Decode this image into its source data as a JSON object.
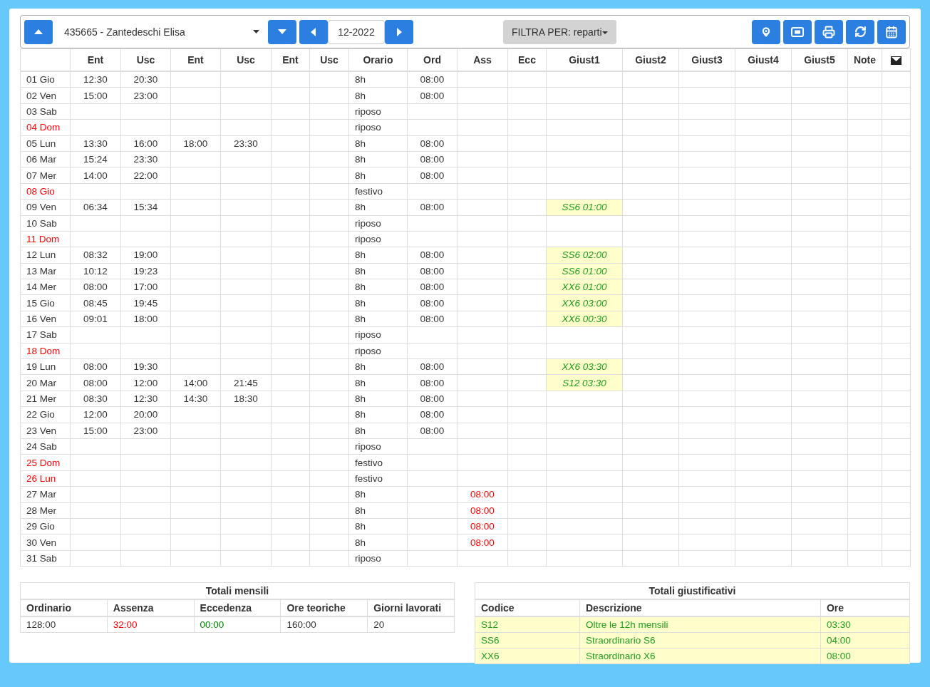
{
  "toolbar": {
    "employee": "435665 - Zantedeschi Elisa",
    "month": "12-2022",
    "filter": "FILTRA PER: reparti"
  },
  "columns": [
    {
      "kind": "text",
      "label": "Ent"
    },
    {
      "kind": "text",
      "label": "Usc"
    },
    {
      "kind": "text",
      "label": "Ent"
    },
    {
      "kind": "text",
      "label": "Usc"
    },
    {
      "kind": "text",
      "label": "Ent"
    },
    {
      "kind": "text",
      "label": "Usc"
    },
    {
      "kind": "text",
      "label": "Orario"
    },
    {
      "kind": "text",
      "label": "Ord"
    },
    {
      "kind": "text",
      "label": "Ass"
    },
    {
      "kind": "text",
      "label": "Ecc"
    },
    {
      "kind": "text",
      "label": "Giust1"
    },
    {
      "kind": "text",
      "label": "Giust2"
    },
    {
      "kind": "text",
      "label": "Giust3"
    },
    {
      "kind": "text",
      "label": "Giust4"
    },
    {
      "kind": "text",
      "label": "Giust5"
    },
    {
      "kind": "text",
      "label": "Note"
    },
    {
      "kind": "mail"
    }
  ],
  "rows": [
    {
      "day": "01 Gio",
      "holiday": false,
      "times": [
        "12:30",
        "20:30"
      ],
      "orario": "8h",
      "ord": "08:00"
    },
    {
      "day": "02 Ven",
      "holiday": false,
      "times": [
        "15:00",
        "23:00"
      ],
      "orario": "8h",
      "ord": "08:00"
    },
    {
      "day": "03 Sab",
      "holiday": false,
      "times": [],
      "orario": "riposo"
    },
    {
      "day": "04 Dom",
      "holiday": true,
      "times": [],
      "orario": "riposo"
    },
    {
      "day": "05 Lun",
      "holiday": false,
      "times": [
        "13:30",
        "16:00",
        "18:00",
        "23:30"
      ],
      "orario": "8h",
      "ord": "08:00"
    },
    {
      "day": "06 Mar",
      "holiday": false,
      "times": [
        "15:24",
        "23:30"
      ],
      "orario": "8h",
      "ord": "08:00"
    },
    {
      "day": "07 Mer",
      "holiday": false,
      "times": [
        "14:00",
        "22:00"
      ],
      "orario": "8h",
      "ord": "08:00"
    },
    {
      "day": "08 Gio",
      "holiday": true,
      "times": [],
      "orario": "festivo"
    },
    {
      "day": "09 Ven",
      "holiday": false,
      "times": [
        "06:34",
        "15:34"
      ],
      "orario": "8h",
      "ord": "08:00",
      "giust": "SS6 01:00"
    },
    {
      "day": "10 Sab",
      "holiday": false,
      "times": [],
      "orario": "riposo"
    },
    {
      "day": "11 Dom",
      "holiday": true,
      "times": [],
      "orario": "riposo"
    },
    {
      "day": "12 Lun",
      "holiday": false,
      "times": [
        "08:32",
        "19:00"
      ],
      "orario": "8h",
      "ord": "08:00",
      "giust": "SS6 02:00"
    },
    {
      "day": "13 Mar",
      "holiday": false,
      "times": [
        "10:12",
        "19:23"
      ],
      "orario": "8h",
      "ord": "08:00",
      "giust": "SS6 01:00"
    },
    {
      "day": "14 Mer",
      "holiday": false,
      "times": [
        "08:00",
        "17:00"
      ],
      "orario": "8h",
      "ord": "08:00",
      "giust": "XX6 01:00"
    },
    {
      "day": "15 Gio",
      "holiday": false,
      "times": [
        "08:45",
        "19:45"
      ],
      "orario": "8h",
      "ord": "08:00",
      "giust": "XX6 03:00"
    },
    {
      "day": "16 Ven",
      "holiday": false,
      "times": [
        "09:01",
        "18:00"
      ],
      "orario": "8h",
      "ord": "08:00",
      "giust": "XX6 00:30"
    },
    {
      "day": "17 Sab",
      "holiday": false,
      "times": [],
      "orario": "riposo"
    },
    {
      "day": "18 Dom",
      "holiday": true,
      "times": [],
      "orario": "riposo"
    },
    {
      "day": "19 Lun",
      "holiday": false,
      "times": [
        "08:00",
        "19:30"
      ],
      "orario": "8h",
      "ord": "08:00",
      "giust": "XX6 03:30"
    },
    {
      "day": "20 Mar",
      "holiday": false,
      "times": [
        "08:00",
        "12:00",
        "14:00",
        "21:45"
      ],
      "orario": "8h",
      "ord": "08:00",
      "giust": "S12 03:30"
    },
    {
      "day": "21 Mer",
      "holiday": false,
      "times": [
        "08:30",
        "12:30",
        "14:30",
        "18:30"
      ],
      "orario": "8h",
      "ord": "08:00"
    },
    {
      "day": "22 Gio",
      "holiday": false,
      "times": [
        "12:00",
        "20:00"
      ],
      "orario": "8h",
      "ord": "08:00"
    },
    {
      "day": "23 Ven",
      "holiday": false,
      "times": [
        "15:00",
        "23:00"
      ],
      "orario": "8h",
      "ord": "08:00"
    },
    {
      "day": "24 Sab",
      "holiday": false,
      "times": [],
      "orario": "riposo"
    },
    {
      "day": "25 Dom",
      "holiday": true,
      "times": [],
      "orario": "festivo"
    },
    {
      "day": "26 Lun",
      "holiday": true,
      "times": [],
      "orario": "festivo"
    },
    {
      "day": "27 Mar",
      "holiday": false,
      "times": [],
      "orario": "8h",
      "ass": "08:00"
    },
    {
      "day": "28 Mer",
      "holiday": false,
      "times": [],
      "orario": "8h",
      "ass": "08:00"
    },
    {
      "day": "29 Gio",
      "holiday": false,
      "times": [],
      "orario": "8h",
      "ass": "08:00"
    },
    {
      "day": "30 Ven",
      "holiday": false,
      "times": [],
      "orario": "8h",
      "ass": "08:00"
    },
    {
      "day": "31 Sab",
      "holiday": false,
      "times": [],
      "orario": "riposo"
    }
  ],
  "monthly_totals": {
    "title": "Totali mensili",
    "items": [
      {
        "label": "Ordinario",
        "value": "128:00",
        "color": "#333333"
      },
      {
        "label": "Assenza",
        "value": "32:00",
        "color": "#ff0000"
      },
      {
        "label": "Eccedenza",
        "value": "00:00",
        "color": "#008000"
      },
      {
        "label": "Ore teoriche",
        "value": "160:00",
        "color": "#333333"
      },
      {
        "label": "Giorni lavorati",
        "value": "20",
        "color": "#333333"
      }
    ]
  },
  "justification_totals": {
    "title": "Totali giustificativi",
    "columns": [
      "Codice",
      "Descrizione",
      "Ore"
    ],
    "rows": [
      [
        "S12",
        "Oltre le 12h mensili",
        "03:30"
      ],
      [
        "SS6",
        "Straordinario S6",
        "04:00"
      ],
      [
        "XX6",
        "Straordinario X6",
        "08:00"
      ]
    ]
  }
}
